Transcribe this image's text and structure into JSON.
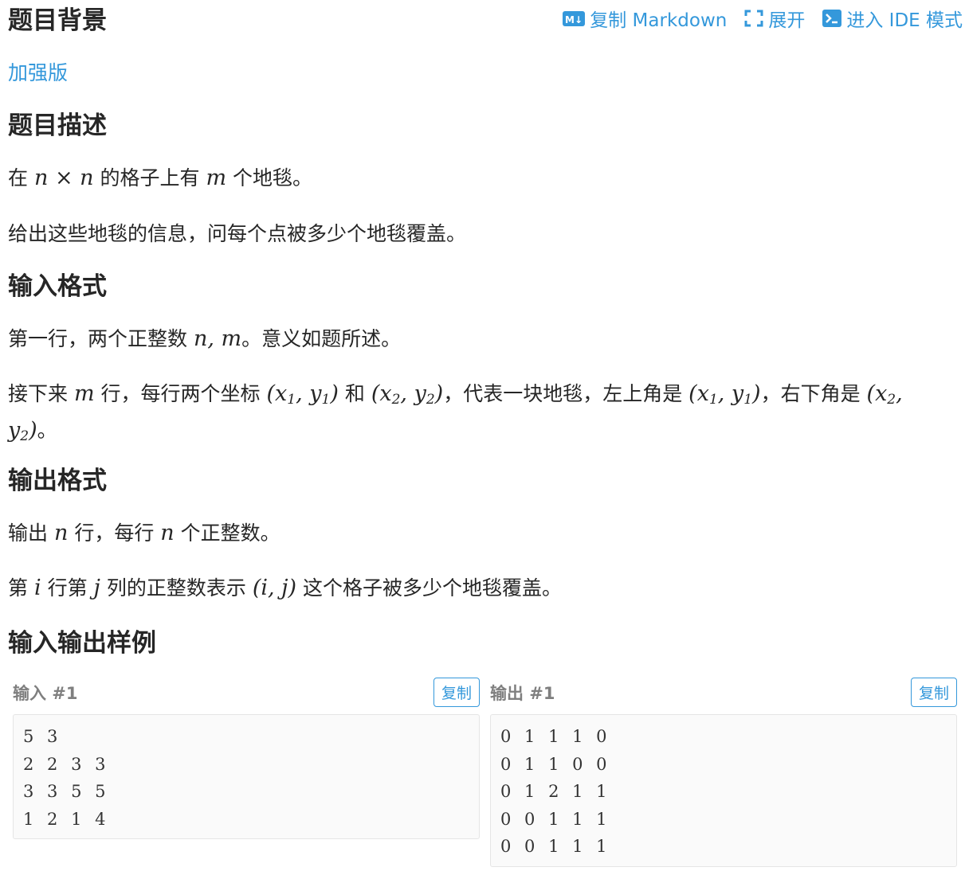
{
  "toolbar": {
    "copy_markdown": "复制 Markdown",
    "expand": "展开",
    "enter_ide": "进入 IDE 模式",
    "icons": [
      "markdown-icon",
      "expand-icon",
      "terminal-icon"
    ],
    "accent": "#3498db"
  },
  "background": {
    "title": "题目背景",
    "link": "加强版"
  },
  "description": {
    "title": "题目描述",
    "p1": {
      "pre": "在",
      "m1": "n × n",
      "mid": "的格子上有",
      "m2": "m",
      "post": "个地毯。"
    },
    "p2": "给出这些地毯的信息，问每个点被多少个地毯覆盖。"
  },
  "input_format": {
    "title": "输入格式",
    "p1": {
      "pre": "第一行，两个正整数",
      "m1": "n, m",
      "post": "。意义如题所述。"
    },
    "p2": {
      "pre": "接下来",
      "m1": "m",
      "t1": "行，每行两个坐标",
      "m2": "(x1, y1)",
      "t2": "和",
      "m3": "(x2, y2)",
      "t3": "，代表一块地毯，左上角是",
      "m4": "(x1, y1)",
      "t4": "，右下角是",
      "m5": "(x2, y2)",
      "post": "。"
    }
  },
  "output_format": {
    "title": "输出格式",
    "p1": {
      "pre": "输出",
      "m1": "n",
      "mid": "行，每行",
      "m2": "n",
      "post": "个正整数。"
    },
    "p2": {
      "pre": "第",
      "m1": "i",
      "t1": "行第",
      "m2": "j",
      "t2": "列的正整数表示",
      "m3": "(i, j)",
      "post": "这个格子被多少个地毯覆盖。"
    }
  },
  "samples": {
    "title": "输入输出样例",
    "input_label": "输入 #1",
    "output_label": "输出 #1",
    "copy_label": "复制",
    "input_lines": [
      "5 3",
      "2 2 3 3",
      "3 3 5 5",
      "1 2 1 4"
    ],
    "output_lines": [
      "0 1 1 1 0",
      "0 1 1 0 0",
      "0 1 2 1 1",
      "0 0 1 1 1",
      "0 0 1 1 1"
    ]
  }
}
